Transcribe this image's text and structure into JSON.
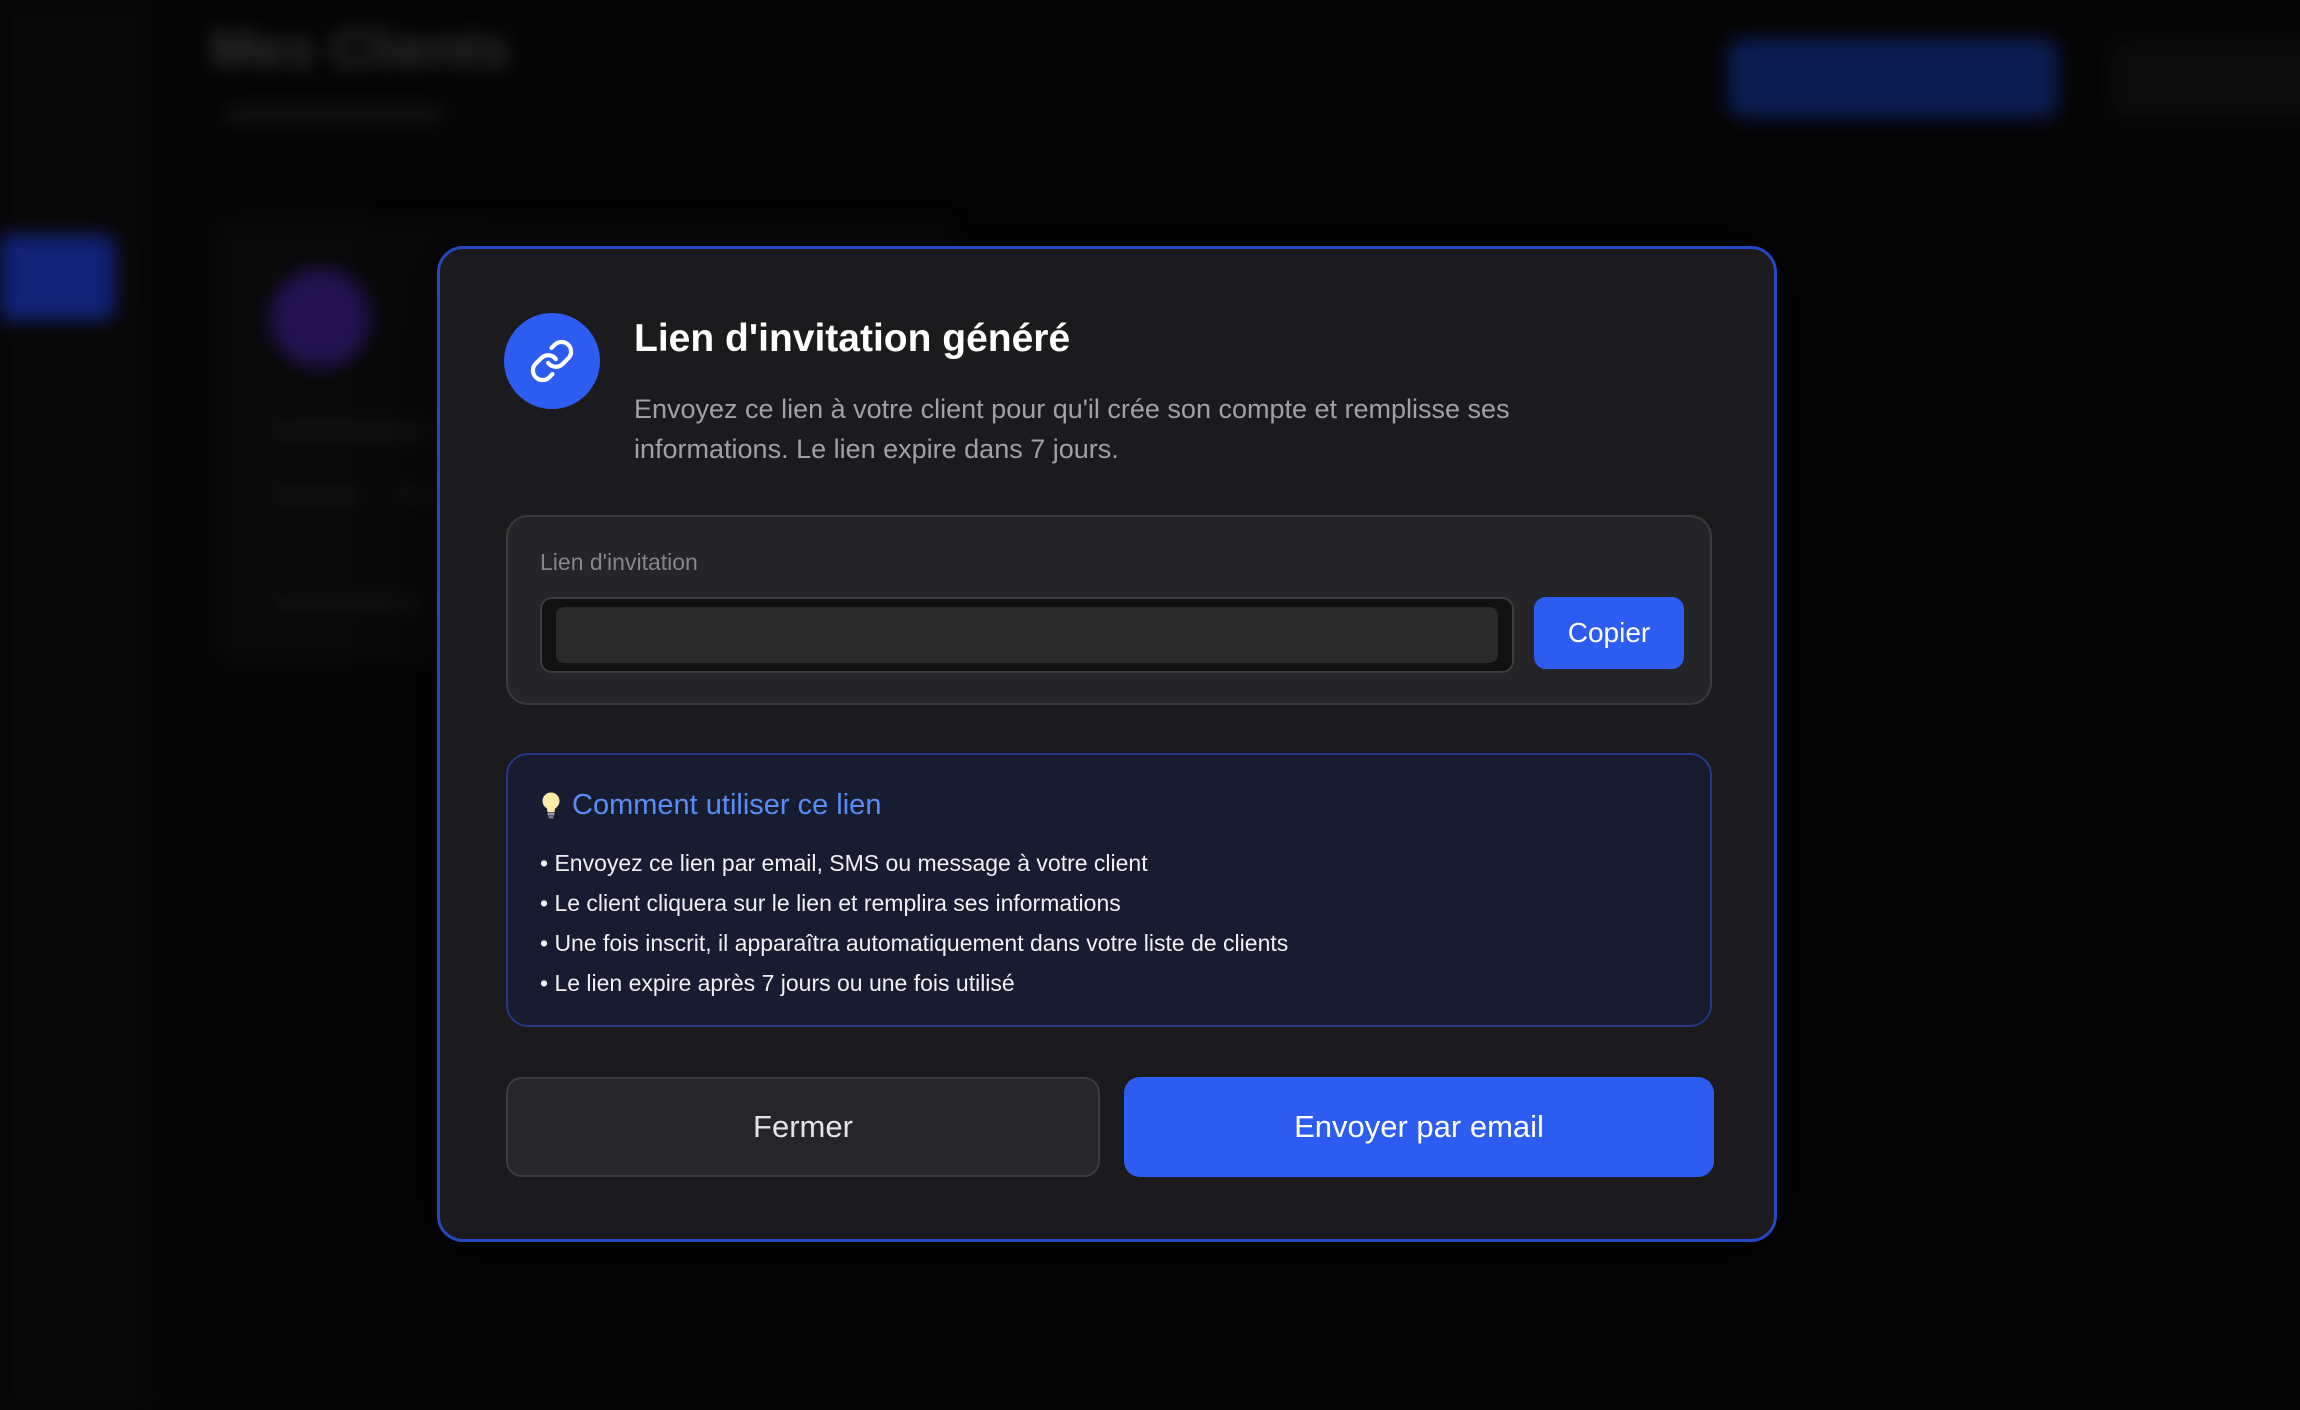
{
  "background": {
    "page_title": "Mes Clients"
  },
  "modal": {
    "icon": "link-icon",
    "title": "Lien d'invitation généré",
    "description": "Envoyez ce lien à votre client pour qu'il crée son compte et remplisse ses informations. Le lien expire dans 7 jours.",
    "link_field": {
      "label": "Lien d'invitation",
      "value": "",
      "copy_label": "Copier"
    },
    "info": {
      "icon": "lightbulb-icon",
      "title": "Comment utiliser ce lien",
      "items": [
        "• Envoyez ce lien par email, SMS ou message à votre client",
        "• Le client cliquera sur le lien et remplira ses informations",
        "• Une fois inscrit, il apparaîtra automatiquement dans votre liste de clients",
        "• Le lien expire après 7 jours ou une fois utilisé"
      ]
    },
    "close_label": "Fermer",
    "email_label": "Envoyer par email"
  },
  "colors": {
    "accent": "#2d5cf0",
    "modal_border": "#2447c2",
    "info_title": "#5a8cf5",
    "modal_bg": "#1b1b1d"
  }
}
